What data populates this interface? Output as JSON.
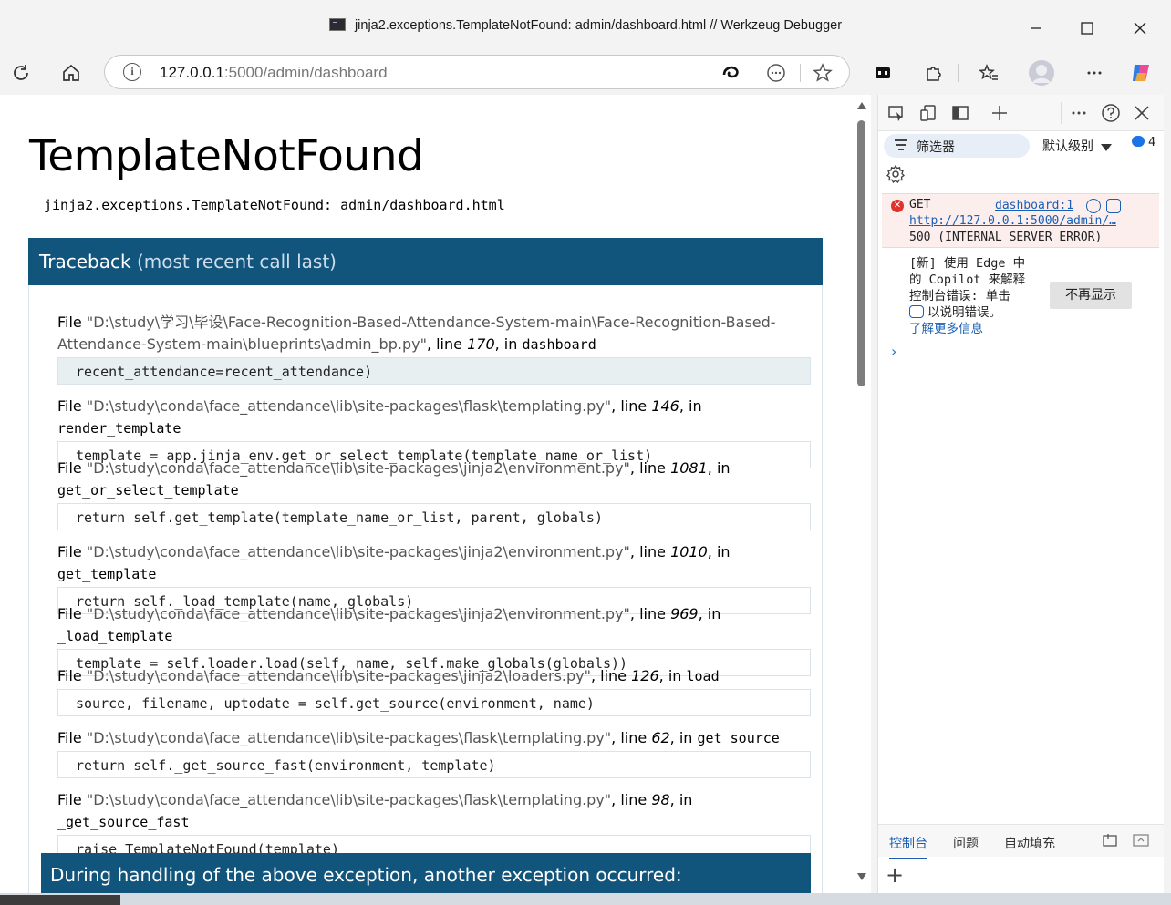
{
  "window": {
    "title": "jinja2.exceptions.TemplateNotFound: admin/dashboard.html // Werkzeug Debugger"
  },
  "address_bar": {
    "url_host": "127.0.0.1",
    "url_rest": ":5000/admin/dashboard"
  },
  "page": {
    "heading": "TemplateNotFound",
    "error_message": "jinja2.exceptions.TemplateNotFound: admin/dashboard.html",
    "traceback_title": "Traceback",
    "traceback_sub": "(most recent call last)",
    "frames": [
      {
        "file_prefix": "File ",
        "file": "\"D:\\study\\学习\\毕设\\Face-Recognition-Based-Attendance-System-main\\Face-Recognition-Based-Attendance-System-main\\blueprints\\admin_bp.py\"",
        "line_prefix": ", line ",
        "line": "170",
        "in": ", in ",
        "func": "dashboard",
        "code": "recent_attendance=recent_attendance)"
      },
      {
        "file_prefix": "File ",
        "file": "\"D:\\study\\conda\\face_attendance\\lib\\site-packages\\flask\\templating.py\"",
        "line_prefix": ", line ",
        "line": "146",
        "in": ", in ",
        "func": "render_template",
        "code": "template = app.jinja_env.get_or_select_template(template_name_or_list)"
      },
      {
        "file_prefix": "File ",
        "file": "\"D:\\study\\conda\\face_attendance\\lib\\site-packages\\jinja2\\environment.py\"",
        "line_prefix": ", line ",
        "line": "1081",
        "in": ", in ",
        "func": "get_or_select_template",
        "code": "return self.get_template(template_name_or_list, parent, globals)"
      },
      {
        "file_prefix": "File ",
        "file": "\"D:\\study\\conda\\face_attendance\\lib\\site-packages\\jinja2\\environment.py\"",
        "line_prefix": ", line ",
        "line": "1010",
        "in": ", in ",
        "func": "get_template",
        "code": "return self._load_template(name, globals)"
      },
      {
        "file_prefix": "File ",
        "file": "\"D:\\study\\conda\\face_attendance\\lib\\site-packages\\jinja2\\environment.py\"",
        "line_prefix": ", line ",
        "line": "969",
        "in": ", in ",
        "func": "_load_template",
        "code": "template = self.loader.load(self, name, self.make_globals(globals))"
      },
      {
        "file_prefix": "File ",
        "file": "\"D:\\study\\conda\\face_attendance\\lib\\site-packages\\jinja2\\loaders.py\"",
        "line_prefix": ", line ",
        "line": "126",
        "in": ", in ",
        "func": "load",
        "code": "source, filename, uptodate = self.get_source(environment, name)"
      },
      {
        "file_prefix": "File ",
        "file": "\"D:\\study\\conda\\face_attendance\\lib\\site-packages\\flask\\templating.py\"",
        "line_prefix": ", line ",
        "line": "62",
        "in": ", in ",
        "func": "get_source",
        "code": "return self._get_source_fast(environment, template)"
      },
      {
        "file_prefix": "File ",
        "file": "\"D:\\study\\conda\\face_attendance\\lib\\site-packages\\flask\\templating.py\"",
        "line_prefix": ", line ",
        "line": "98",
        "in": ", in ",
        "func": "_get_source_fast",
        "code": "raise TemplateNotFound(template)"
      }
    ],
    "during_text": "During handling of the above exception, another exception occurred:"
  },
  "devtools": {
    "filter_label": "筛选器",
    "level_label": "默认级别",
    "issue_count": "4",
    "error": {
      "method": "GET",
      "source": "dashboard:1",
      "url": "http://127.0.0.1:5000/admin/…",
      "status": "500 (INTERNAL SERVER ERROR)"
    },
    "copilot_line1": "[新] 使用 Edge 中",
    "copilot_line2": "的 Copilot 来解释",
    "copilot_line3": "控制台错误: 单击",
    "copilot_line4": "以说明错误。",
    "copilot_link": "了解更多信息",
    "dismiss_label": "不再显示",
    "tabs": [
      "控制台",
      "问题",
      "自动填充"
    ]
  },
  "colors": {
    "traceback_header": "#11557c",
    "error_bg": "#fdeeee",
    "link": "#1a5fb4"
  }
}
